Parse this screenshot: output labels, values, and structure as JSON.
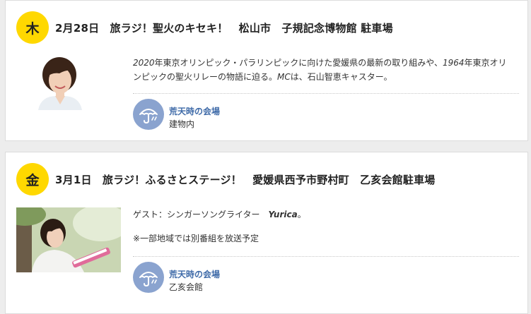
{
  "events": [
    {
      "day": "木",
      "title": "2月28日　旅ラジ！聖火のキセキ！　松山市　子規記念博物館 駐車場",
      "desc_parts": [
        "2020",
        "年東京オリンピック・パラリンピックに向けた愛媛県の最新の取り組みや、",
        "1964",
        "年東京オリンピックの聖火リレーの物語に迫る。",
        "MC",
        "は、石山智恵キャスター。"
      ],
      "venue_label": "荒天時の会場",
      "venue_place": "建物内"
    },
    {
      "day": "金",
      "title": "3月1日　旅ラジ！ふるさとステージ！　愛媛県西予市野村町　乙亥会館駐車場",
      "guest_prefix": "ゲスト：シンガーソングライター　",
      "guest_name": "Yurica",
      "guest_suffix": "。",
      "note": "※一部地域では別番組を放送予定",
      "venue_label": "荒天時の会場",
      "venue_place": "乙亥会館"
    }
  ],
  "colors": {
    "badge": "#ffd800",
    "venue_icon_bg": "#8aa3cf",
    "venue_label": "#3e6aa8"
  },
  "icons": {
    "venue": "umbrella-rain-icon"
  }
}
